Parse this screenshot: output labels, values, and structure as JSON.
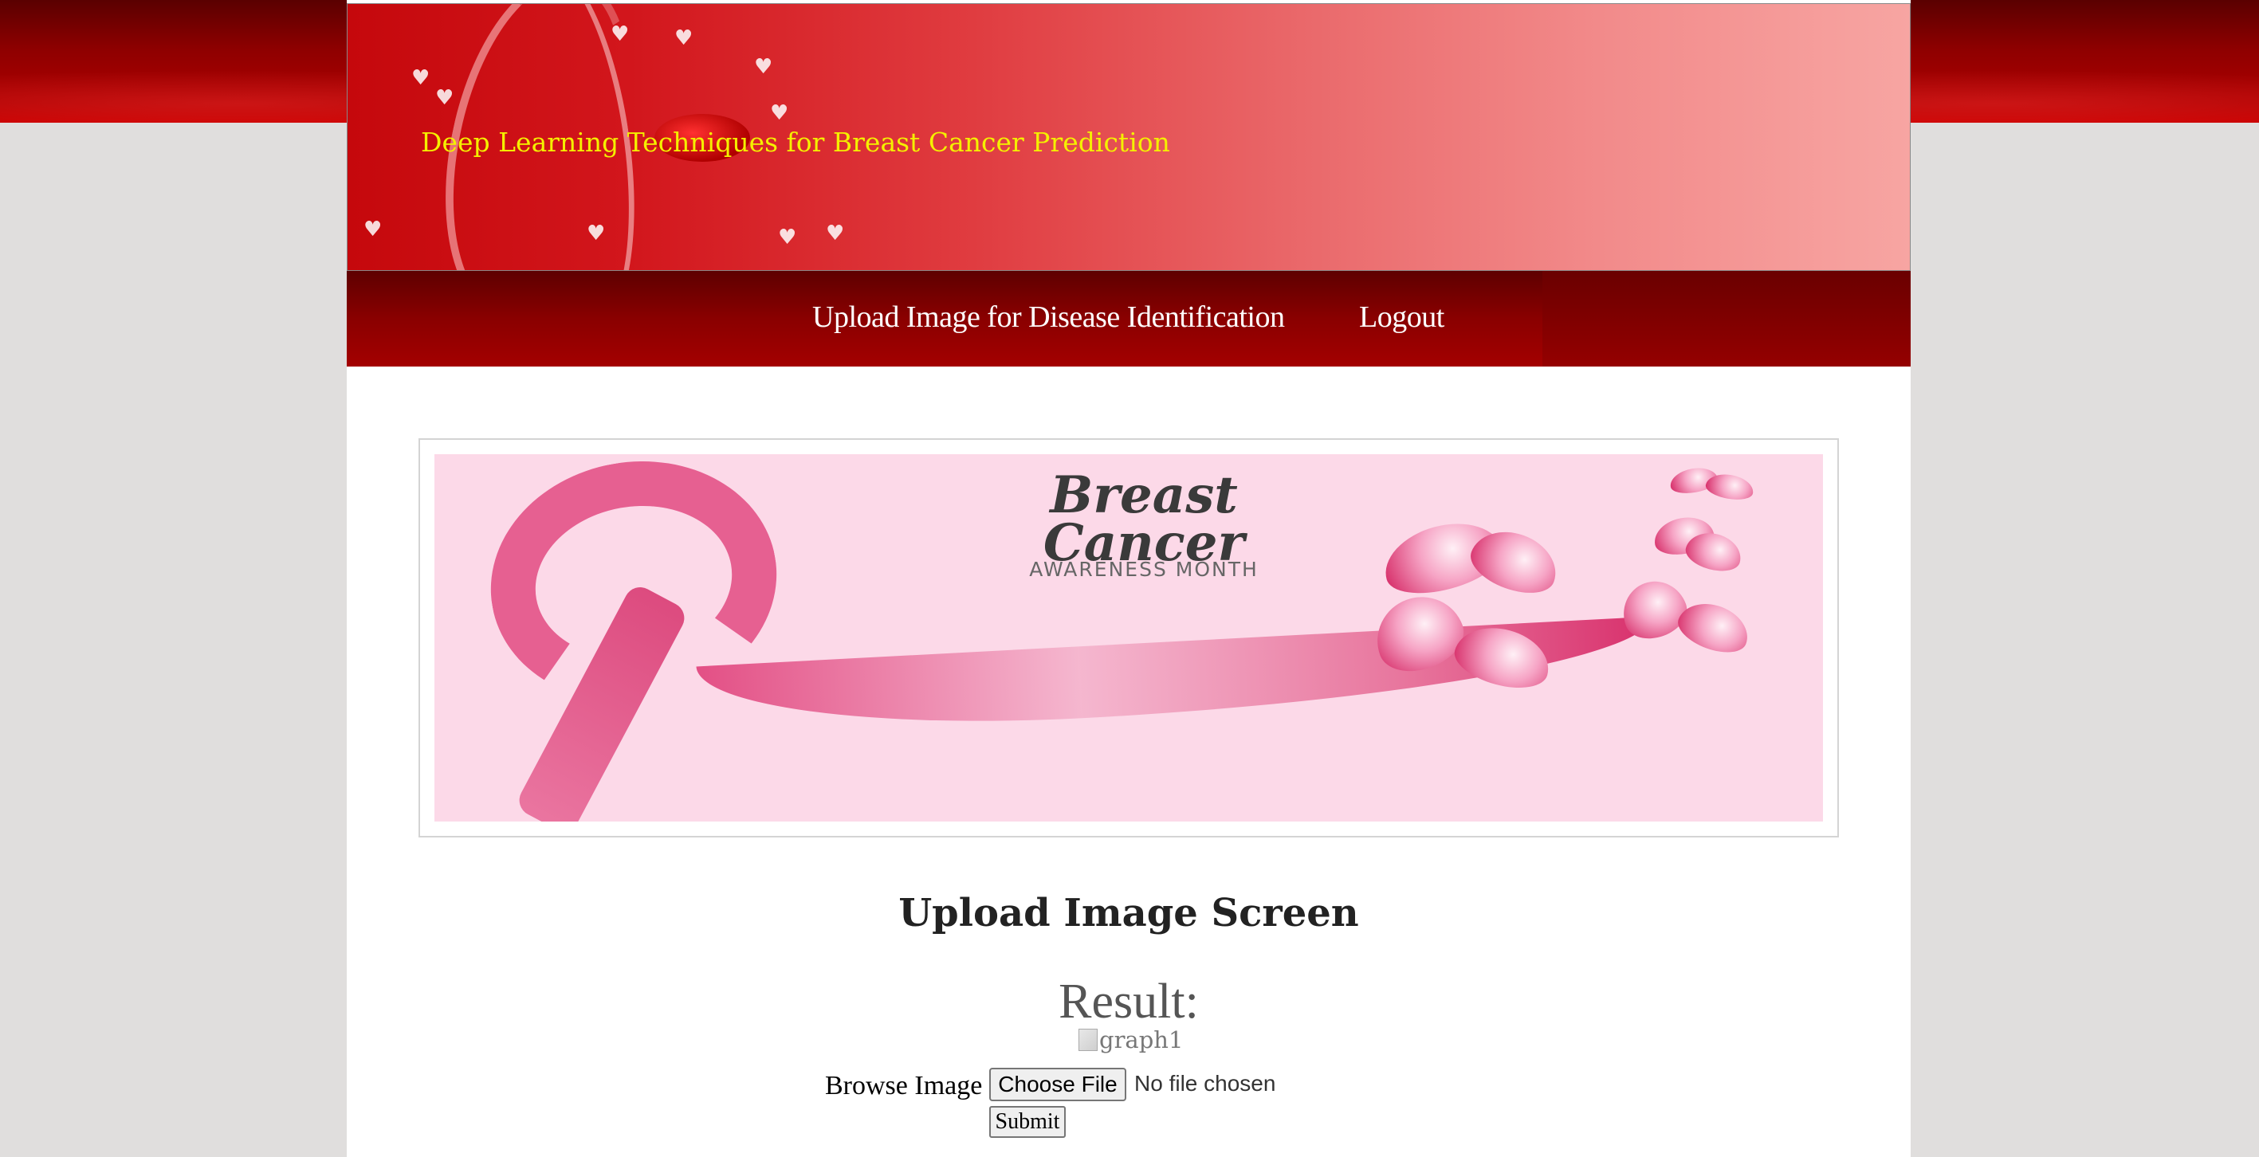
{
  "header": {
    "title": "Deep Learning Techniques for Breast Cancer Prediction"
  },
  "nav": {
    "items": [
      {
        "label": "Upload Image for Disease Identification"
      },
      {
        "label": "Logout"
      }
    ]
  },
  "banner": {
    "heading": "Breast Cancer",
    "subheading": "AWARENESS MONTH"
  },
  "main": {
    "heading": "Upload Image Screen",
    "result_label": "Result:",
    "result_image_alt": "graph1",
    "browse_label": "Browse Image",
    "file_button_label": "Choose File",
    "file_status": "No file chosen",
    "submit_label": "Submit"
  },
  "colors": {
    "title_text": "#f4f000",
    "header_red": "#c5080c",
    "nav_dark_red": "#8a0000",
    "banner_pink": "#fcd9e8"
  }
}
